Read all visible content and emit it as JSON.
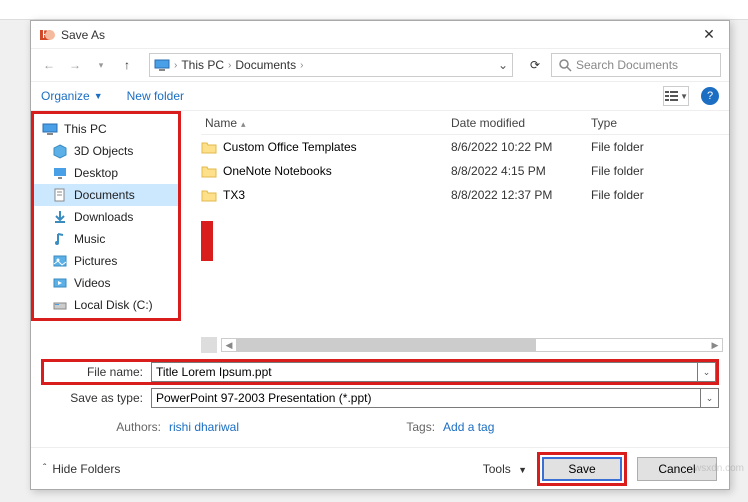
{
  "dialog": {
    "title": "Save As",
    "breadcrumb": {
      "root": "This PC",
      "folder": "Documents"
    },
    "search_placeholder": "Search Documents",
    "organize": "Organize",
    "newfolder": "New folder"
  },
  "sidebar": {
    "root": "This PC",
    "items": [
      "3D Objects",
      "Desktop",
      "Documents",
      "Downloads",
      "Music",
      "Pictures",
      "Videos",
      "Local Disk (C:)"
    ],
    "selected": "Documents"
  },
  "columns": {
    "name": "Name",
    "date": "Date modified",
    "type": "Type"
  },
  "rows": [
    {
      "name": "Custom Office Templates",
      "date": "8/6/2022 10:22 PM",
      "type": "File folder"
    },
    {
      "name": "OneNote Notebooks",
      "date": "8/8/2022 4:15 PM",
      "type": "File folder"
    },
    {
      "name": "TX3",
      "date": "8/8/2022 12:37 PM",
      "type": "File folder"
    }
  ],
  "form": {
    "filename_label": "File name:",
    "filename_value": "Title Lorem Ipsum.ppt",
    "type_label": "Save as type:",
    "type_value": "PowerPoint 97-2003 Presentation (*.ppt)",
    "authors_label": "Authors:",
    "authors_value": "rishi dhariwal",
    "tags_label": "Tags:",
    "tags_value": "Add a tag"
  },
  "footer": {
    "hide": "Hide Folders",
    "tools": "Tools",
    "save": "Save",
    "cancel": "Cancel"
  },
  "watermark": "wsxdn.com"
}
